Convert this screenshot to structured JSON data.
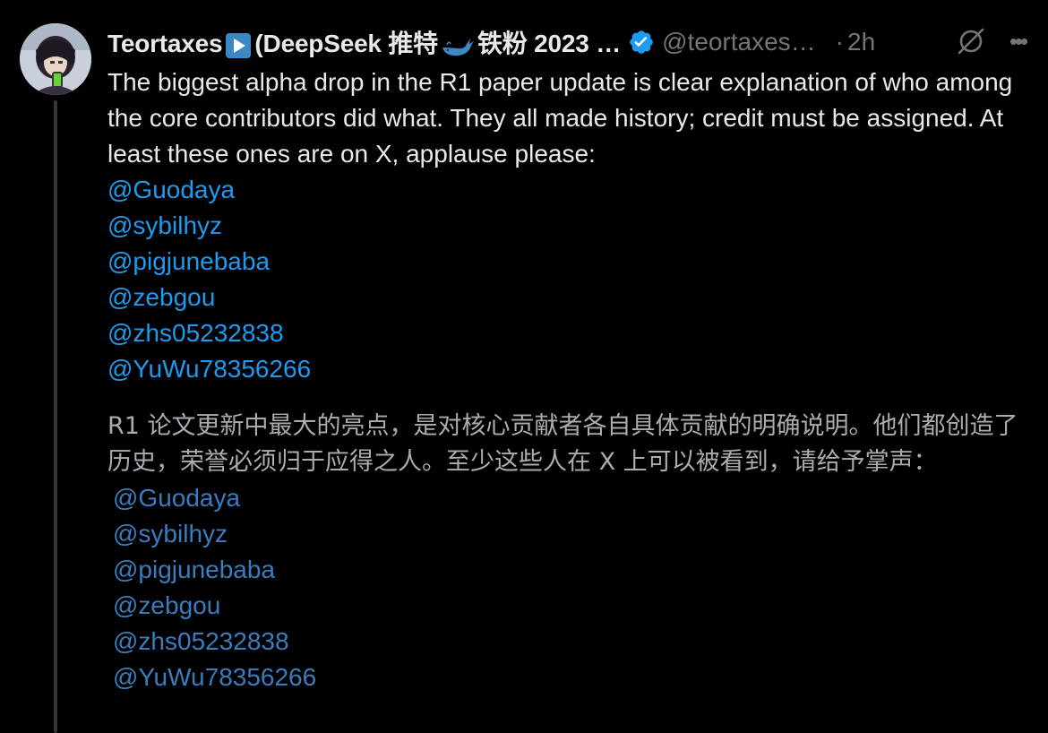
{
  "tweet": {
    "display_name_part1": "Teortaxes",
    "display_name_part2": "(DeepSeek 推特",
    "display_name_part3": "铁粉 2023 …",
    "handle": "@teortaxes…",
    "separator": "·",
    "time": "2h",
    "text_en": "The biggest alpha drop in the R1 paper update is clear explanation of who among the core contributors did what. They all made history; credit must be assigned. At least these ones are on X, applause please:",
    "mentions_en": [
      "@Guodaya",
      "@sybilhyz",
      "@pigjunebaba",
      "@zebgou",
      "@zhs05232838",
      "@YuWu78356266"
    ],
    "text_zh": "R1 论文更新中最大的亮点，是对核心贡献者各自具体贡献的明确说明。他们都创造了历史，荣誉必须归于应得之人。至少这些人在 X 上可以被看到，请给予掌声：",
    "mentions_zh": [
      "@Guodaya",
      "@sybilhyz",
      "@pigjunebaba",
      "@zebgou",
      "@zhs05232838",
      "@YuWu78356266"
    ]
  },
  "icons": {
    "play": "play-button-emoji",
    "whale": "whale-emoji",
    "verified": "verified-badge-icon",
    "grok": "grok-icon",
    "more": "more-options-icon"
  },
  "colors": {
    "background": "#000000",
    "text_primary": "#e7e9ea",
    "text_secondary": "#71767b",
    "link": "#1d9bf0",
    "verified": "#1d9bf0"
  }
}
